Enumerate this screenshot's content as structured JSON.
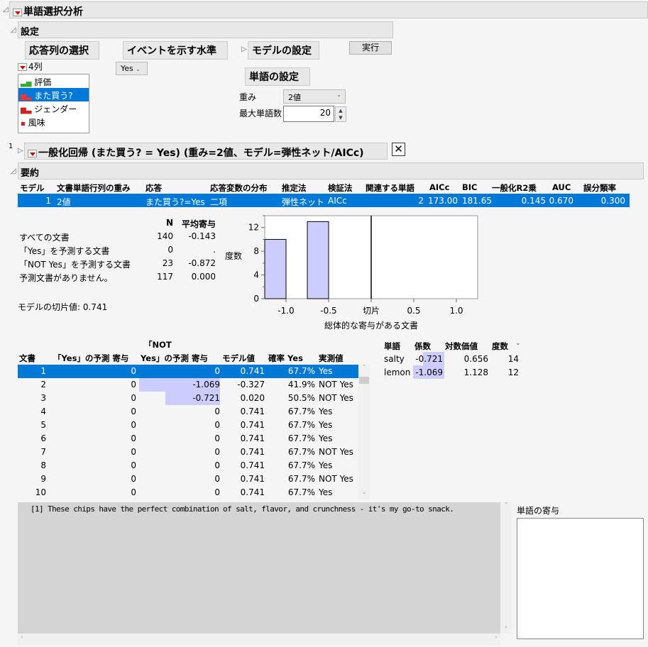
{
  "title": "単語選択分析",
  "settings": {
    "title": "設定",
    "response_header": "応答列の選択",
    "event_header": "イベントを示す水準",
    "model_header": "モデルの設定",
    "run_button": "実行",
    "columns_count": "4列",
    "columns": [
      {
        "label": "評価",
        "icon": "continuous-icon"
      },
      {
        "label": "また買う?",
        "icon": "nominal-icon"
      },
      {
        "label": "ジェンダー",
        "icon": "nominal-icon"
      },
      {
        "label": "風味",
        "icon": "nominal-icon"
      }
    ],
    "event_value": "Yes",
    "word_settings": "単語の設定",
    "weight_label": "重み",
    "weight_value": "2値",
    "max_words_label": "最大単語数",
    "max_words_value": "20"
  },
  "model": {
    "index": "1",
    "title": "一般化回帰 (また買う? = Yes) (重み=2値、モデル=弾性ネット/AICc)"
  },
  "summary": {
    "title": "要約",
    "headers": [
      "モデル",
      "文書単語行列の重み",
      "応答",
      "応答変数の分布",
      "推定法",
      "検証法",
      "関連する単語",
      "AICc",
      "BIC",
      "一般化R2乗",
      "AUC",
      "誤分類率"
    ],
    "row": [
      "1",
      "2値",
      "また買う?=Yes",
      "二項",
      "弾性ネット",
      "AICc",
      "2",
      "173.00",
      "181.65",
      "0.145",
      "0.670",
      "0.300"
    ]
  },
  "doc_stats": {
    "headers": [
      "N",
      "平均寄与"
    ],
    "rows": [
      [
        "すべての文書",
        "140",
        "-0.143"
      ],
      [
        "「Yes」を予測する文書",
        "0",
        "."
      ],
      [
        "「NOT Yes」を予測する文書",
        "23",
        "-0.872"
      ],
      [
        "予測文書がありません。",
        "117",
        "0.000"
      ]
    ],
    "intercept": "モデルの切片値: 0.741"
  },
  "chart_data": {
    "type": "bar",
    "title": "",
    "xlabel": "総体的な寄与がある文書",
    "ylabel": "度数",
    "xlim": [
      -1.25,
      1.25
    ],
    "ylim": [
      0,
      14
    ],
    "bins": [
      {
        "from": -1.25,
        "to": -1.0,
        "count": 10
      },
      {
        "from": -0.75,
        "to": -0.5,
        "count": 13
      }
    ],
    "xticks": [
      {
        "v": -1.0,
        "label": "-1.0"
      },
      {
        "v": -0.5,
        "label": "-0.5"
      },
      {
        "v": 0,
        "label": "切片"
      },
      {
        "v": 0.5,
        "label": "0.5"
      },
      {
        "v": 1.0,
        "label": "1.0"
      }
    ],
    "yticks": [
      0,
      4,
      8,
      12
    ],
    "reference_line": 0
  },
  "doc_table": {
    "header_top": "「NOT",
    "headers": [
      "文書",
      "「Yes」の予測 寄与",
      "Yes」の予測 寄与",
      "モデル値",
      "確率 Yes",
      "実測値"
    ],
    "rows": [
      [
        "1",
        "0",
        "0",
        "0.741",
        "67.7%",
        "Yes"
      ],
      [
        "2",
        "0",
        "-1.069",
        "-0.327",
        "41.9%",
        "NOT Yes"
      ],
      [
        "3",
        "0",
        "-0.721",
        "0.020",
        "50.5%",
        "NOT Yes"
      ],
      [
        "4",
        "0",
        "0",
        "0.741",
        "67.7%",
        "Yes"
      ],
      [
        "5",
        "0",
        "0",
        "0.741",
        "67.7%",
        "Yes"
      ],
      [
        "6",
        "0",
        "0",
        "0.741",
        "67.7%",
        "Yes"
      ],
      [
        "7",
        "0",
        "0",
        "0.741",
        "67.7%",
        "NOT Yes"
      ],
      [
        "8",
        "0",
        "0",
        "0.741",
        "67.7%",
        "Yes"
      ],
      [
        "9",
        "0",
        "0",
        "0.741",
        "67.7%",
        "NOT Yes"
      ],
      [
        "10",
        "0",
        "0",
        "0.741",
        "67.7%",
        "Yes"
      ]
    ]
  },
  "word_table": {
    "headers": [
      "単語",
      "係数",
      "対数価値",
      "度数"
    ],
    "rows": [
      [
        "salty",
        "-0.721",
        "0.656",
        "14"
      ],
      [
        "lemon",
        "-1.069",
        "1.128",
        "12"
      ]
    ]
  },
  "text_view": {
    "content": "[1] These chips have the perfect combination of salt, flavor, and crunchness - it's my go-to snack."
  },
  "word_contrib": {
    "title": "単語の寄与"
  }
}
